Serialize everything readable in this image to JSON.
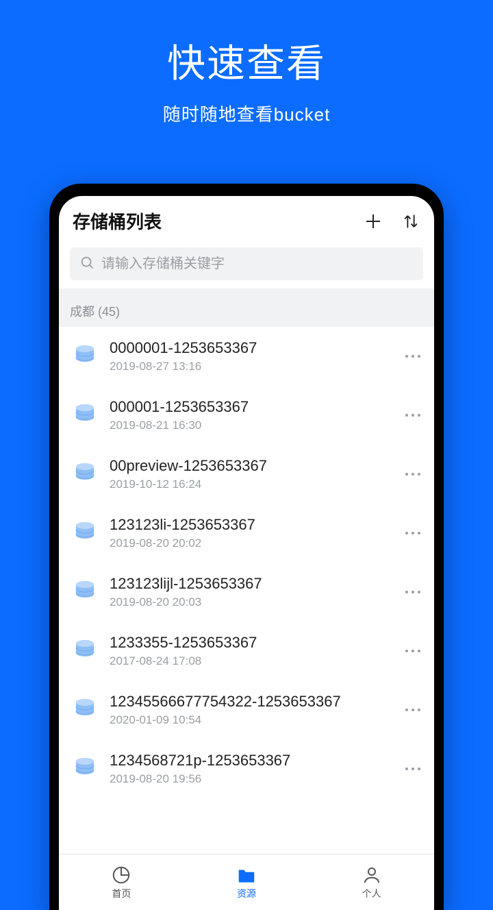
{
  "hero": {
    "title": "快速查看",
    "subtitle": "随时随地查看bucket"
  },
  "nav": {
    "title": "存储桶列表"
  },
  "search": {
    "placeholder": "请输入存储桶关键字"
  },
  "section": {
    "label": "成都 (45)"
  },
  "buckets": [
    {
      "name": "0000001-1253653367",
      "time": "2019-08-27 13:16"
    },
    {
      "name": "000001-1253653367",
      "time": "2019-08-21 16:30"
    },
    {
      "name": "00preview-1253653367",
      "time": "2019-10-12 16:24"
    },
    {
      "name": "123123li-1253653367",
      "time": "2019-08-20 20:02"
    },
    {
      "name": "123123lijl-1253653367",
      "time": "2019-08-20 20:03"
    },
    {
      "name": "1233355-1253653367",
      "time": "2017-08-24 17:08"
    },
    {
      "name": "12345566677754322-1253653367",
      "time": "2020-01-09 10:54"
    },
    {
      "name": "1234568721p-1253653367",
      "time": "2019-08-20 19:56"
    }
  ],
  "tabs": [
    {
      "label": "首页"
    },
    {
      "label": "资源"
    },
    {
      "label": "个人"
    }
  ]
}
